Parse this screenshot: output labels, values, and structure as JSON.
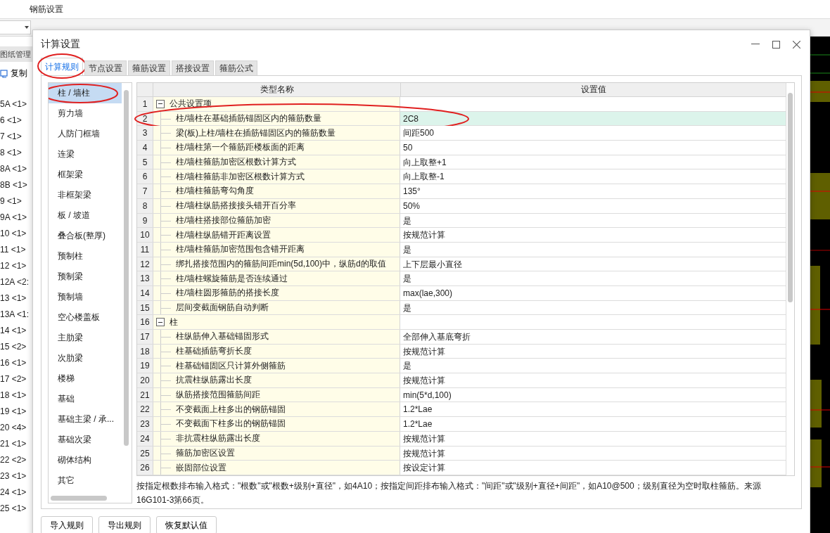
{
  "app": {
    "title": "钢筋设置",
    "left_panel": {
      "tab": "图纸管理",
      "copy_button": "复制",
      "items": [
        "5A <1>",
        "6 <1>",
        "7 <1>",
        "8 <1>",
        "8A <1>",
        "8B <1>",
        "9 <1>",
        "9A <1>",
        "10 <1>",
        "11 <1>",
        "12 <1>",
        "12A <2:",
        "13 <1>",
        "13A <1:",
        "14 <1>",
        "15 <2>",
        "16 <1>",
        "17 <2>",
        "18 <1>",
        "19 <1>",
        "20 <4>",
        "21 <1>",
        "22 <2>",
        "23 <1>",
        "24 <1>",
        "25 <1>"
      ]
    }
  },
  "dialog": {
    "title": "计算设置",
    "tabs": [
      {
        "label": "计算规则",
        "selected": true,
        "circled": true
      },
      {
        "label": "节点设置",
        "selected": false,
        "circled": false
      },
      {
        "label": "箍筋设置",
        "selected": false,
        "circled": false
      },
      {
        "label": "搭接设置",
        "selected": false,
        "circled": false
      },
      {
        "label": "箍筋公式",
        "selected": false,
        "circled": false
      }
    ],
    "categories": [
      {
        "label": "柱 / 墙柱",
        "selected": true,
        "circled": true
      },
      {
        "label": "剪力墙",
        "selected": false,
        "circled": false
      },
      {
        "label": "人防门框墙",
        "selected": false,
        "circled": false
      },
      {
        "label": "连梁",
        "selected": false,
        "circled": false
      },
      {
        "label": "框架梁",
        "selected": false,
        "circled": false
      },
      {
        "label": "非框架梁",
        "selected": false,
        "circled": false
      },
      {
        "label": "板 / 坡道",
        "selected": false,
        "circled": false
      },
      {
        "label": "叠合板(整厚)",
        "selected": false,
        "circled": false
      },
      {
        "label": "预制柱",
        "selected": false,
        "circled": false
      },
      {
        "label": "预制梁",
        "selected": false,
        "circled": false
      },
      {
        "label": "预制墙",
        "selected": false,
        "circled": false
      },
      {
        "label": "空心楼盖板",
        "selected": false,
        "circled": false
      },
      {
        "label": "主肋梁",
        "selected": false,
        "circled": false
      },
      {
        "label": "次肋梁",
        "selected": false,
        "circled": false
      },
      {
        "label": "楼梯",
        "selected": false,
        "circled": false
      },
      {
        "label": "基础",
        "selected": false,
        "circled": false
      },
      {
        "label": "基础主梁 / 承...",
        "selected": false,
        "circled": false
      },
      {
        "label": "基础次梁",
        "selected": false,
        "circled": false
      },
      {
        "label": "砌体结构",
        "selected": false,
        "circled": false
      },
      {
        "label": "其它",
        "selected": false,
        "circled": false
      }
    ],
    "table": {
      "columns": [
        "类型名称",
        "设置值"
      ],
      "groups": [
        {
          "num": "1",
          "label": "公共设置项",
          "expanded": true,
          "children": [
            {
              "num": "2",
              "name": "柱/墙柱在基础插筋锚固区内的箍筋数量",
              "value": "2C8",
              "selected": true,
              "circled": true
            },
            {
              "num": "3",
              "name": "梁(板)上柱/墙柱在插筋锚固区内的箍筋数量",
              "value": "间距500",
              "selected": false,
              "circled": false
            },
            {
              "num": "4",
              "name": "柱/墙柱第一个箍筋距楼板面的距离",
              "value": "50",
              "selected": false,
              "circled": false
            },
            {
              "num": "5",
              "name": "柱/墙柱箍筋加密区根数计算方式",
              "value": "向上取整+1",
              "selected": false,
              "circled": false
            },
            {
              "num": "6",
              "name": "柱/墙柱箍筋非加密区根数计算方式",
              "value": "向上取整-1",
              "selected": false,
              "circled": false
            },
            {
              "num": "7",
              "name": "柱/墙柱箍筋弯勾角度",
              "value": "135°",
              "selected": false,
              "circled": false
            },
            {
              "num": "8",
              "name": "柱/墙柱纵筋搭接接头错开百分率",
              "value": "50%",
              "selected": false,
              "circled": false
            },
            {
              "num": "9",
              "name": "柱/墙柱搭接部位箍筋加密",
              "value": "是",
              "selected": false,
              "circled": false
            },
            {
              "num": "10",
              "name": "柱/墙柱纵筋错开距离设置",
              "value": "按规范计算",
              "selected": false,
              "circled": false
            },
            {
              "num": "11",
              "name": "柱/墙柱箍筋加密范围包含错开距离",
              "value": "是",
              "selected": false,
              "circled": false
            },
            {
              "num": "12",
              "name": "绑扎搭接范围内的箍筋间距min(5d,100)中，纵筋d的取值",
              "value": "上下层最小直径",
              "selected": false,
              "circled": false
            },
            {
              "num": "13",
              "name": "柱/墙柱螺旋箍筋是否连续通过",
              "value": "是",
              "selected": false,
              "circled": false
            },
            {
              "num": "14",
              "name": "柱/墙柱圆形箍筋的搭接长度",
              "value": "max(lae,300)",
              "selected": false,
              "circled": false
            },
            {
              "num": "15",
              "name": "层间变截面钢筋自动判断",
              "value": "是",
              "selected": false,
              "circled": false
            }
          ]
        },
        {
          "num": "16",
          "label": "柱",
          "expanded": true,
          "children": [
            {
              "num": "17",
              "name": "柱纵筋伸入基础锚固形式",
              "value": "全部伸入基底弯折",
              "selected": false,
              "circled": false
            },
            {
              "num": "18",
              "name": "柱基础插筋弯折长度",
              "value": "按规范计算",
              "selected": false,
              "circled": false
            },
            {
              "num": "19",
              "name": "柱基础锚固区只计算外侧箍筋",
              "value": "是",
              "selected": false,
              "circled": false
            },
            {
              "num": "20",
              "name": "抗震柱纵筋露出长度",
              "value": "按规范计算",
              "selected": false,
              "circled": false
            },
            {
              "num": "21",
              "name": "纵筋搭接范围箍筋间距",
              "value": "min(5*d,100)",
              "selected": false,
              "circled": false
            },
            {
              "num": "22",
              "name": "不变截面上柱多出的钢筋锚固",
              "value": "1.2*Lae",
              "selected": false,
              "circled": false
            },
            {
              "num": "23",
              "name": "不变截面下柱多出的钢筋锚固",
              "value": "1.2*Lae",
              "selected": false,
              "circled": false
            },
            {
              "num": "24",
              "name": "非抗震柱纵筋露出长度",
              "value": "按规范计算",
              "selected": false,
              "circled": false
            },
            {
              "num": "25",
              "name": "箍筋加密区设置",
              "value": "按规范计算",
              "selected": false,
              "circled": false
            },
            {
              "num": "26",
              "name": "嵌固部位设置",
              "value": "按设定计算",
              "selected": false,
              "circled": false
            }
          ]
        }
      ]
    },
    "note": "按指定根数排布输入格式：\"根数\"或\"根数+级别+直径\"，如4A10；按指定间距排布输入格式：\"间距\"或\"级别+直径+间距\"，如A10@500；级别直径为空时取柱箍筋。来源16G101-3第66页。",
    "buttons": [
      "导入规则",
      "导出规则",
      "恢复默认值"
    ]
  }
}
